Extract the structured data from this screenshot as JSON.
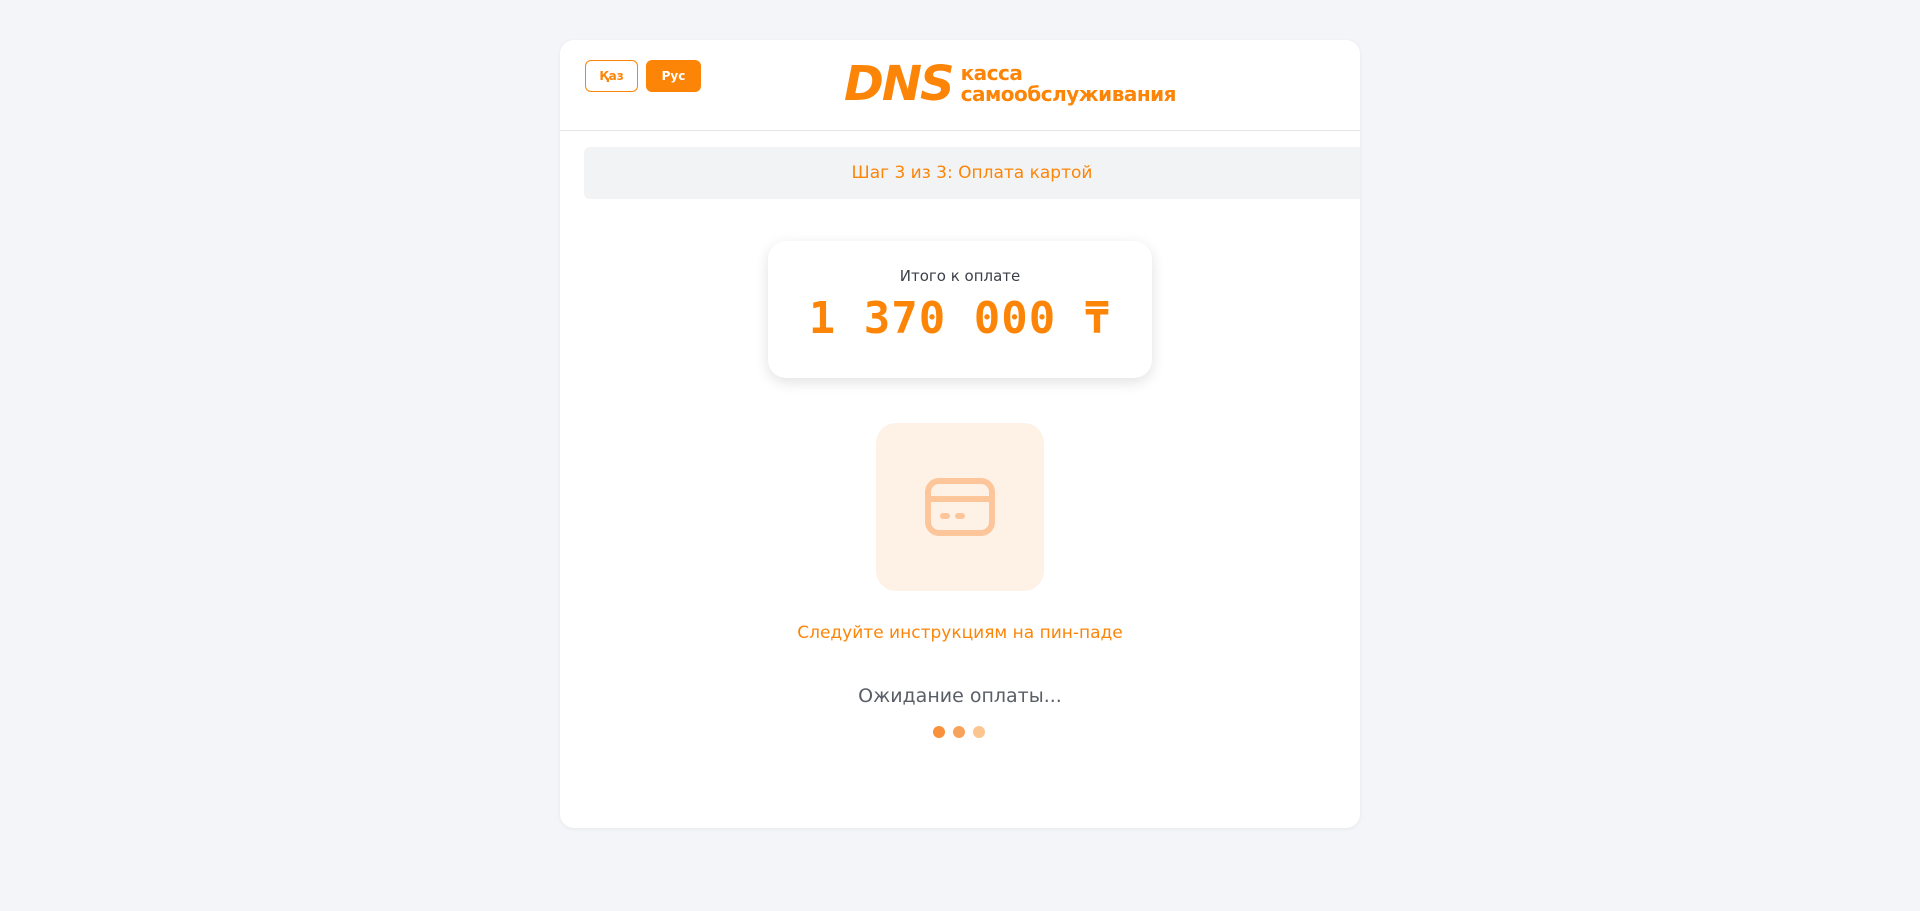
{
  "header": {
    "lang_kaz": "Қаз",
    "lang_rus": "Рус",
    "logo_brand": "DNS",
    "logo_line1": "касса",
    "logo_line2": "самообслуживания"
  },
  "step": {
    "text": "Шаг 3 из 3: Оплата картой"
  },
  "total": {
    "label": "Итого к оплате",
    "amount": "1 370 000 ₸"
  },
  "payment": {
    "icon": "credit-card-icon",
    "instructions": "Следуйте инструкциям на пин-паде",
    "status": "Ожидание оплаты..."
  },
  "colors": {
    "accent": "#fc8507",
    "icon_bg": "#fef2e7",
    "dot_1": "#f9913a",
    "dot_2": "#f8a35c",
    "dot_3": "#fbc58f"
  }
}
